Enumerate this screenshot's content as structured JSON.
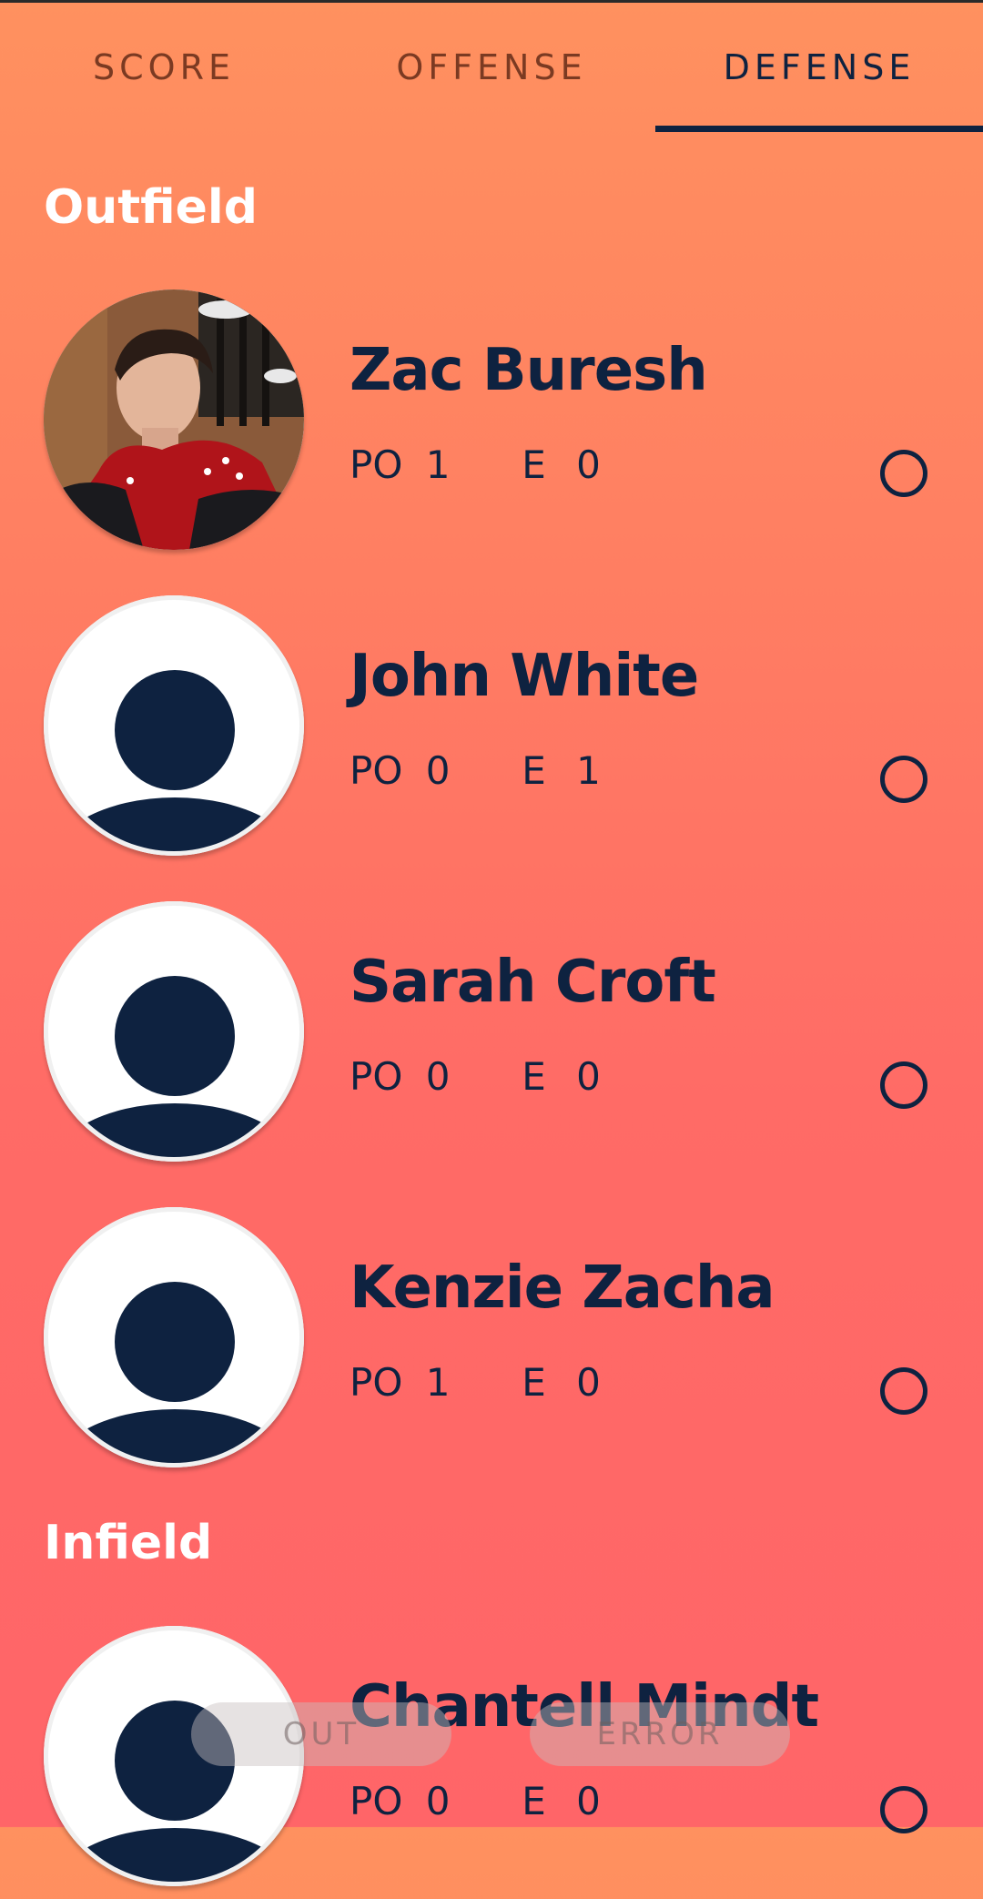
{
  "tabs": [
    {
      "label": "SCORE",
      "active": false
    },
    {
      "label": "OFFENSE",
      "active": false
    },
    {
      "label": "DEFENSE",
      "active": true
    }
  ],
  "sections": [
    {
      "title": "Outfield",
      "players": [
        {
          "name": "Zac Buresh",
          "po_label": "PO",
          "po": "1",
          "e_label": "E",
          "e": "0",
          "avatar": "photo"
        },
        {
          "name": "John White",
          "po_label": "PO",
          "po": "0",
          "e_label": "E",
          "e": "1",
          "avatar": "default-person-icon"
        },
        {
          "name": "Sarah Croft",
          "po_label": "PO",
          "po": "0",
          "e_label": "E",
          "e": "0",
          "avatar": "default-person-icon"
        },
        {
          "name": "Kenzie Zacha",
          "po_label": "PO",
          "po": "1",
          "e_label": "E",
          "e": "0",
          "avatar": "default-person-icon"
        }
      ]
    },
    {
      "title": "Infield",
      "players": [
        {
          "name": "Chantell Mindt",
          "po_label": "PO",
          "po": "0",
          "e_label": "E",
          "e": "0",
          "avatar": "default-person-icon"
        }
      ]
    }
  ],
  "actions": {
    "out_label": "OUT",
    "error_label": "ERROR"
  },
  "colors": {
    "navy": "#0E2240",
    "inactive_tab": "#7B3A22",
    "gradient_top": "#FF915F",
    "gradient_bottom": "#FF6568"
  }
}
